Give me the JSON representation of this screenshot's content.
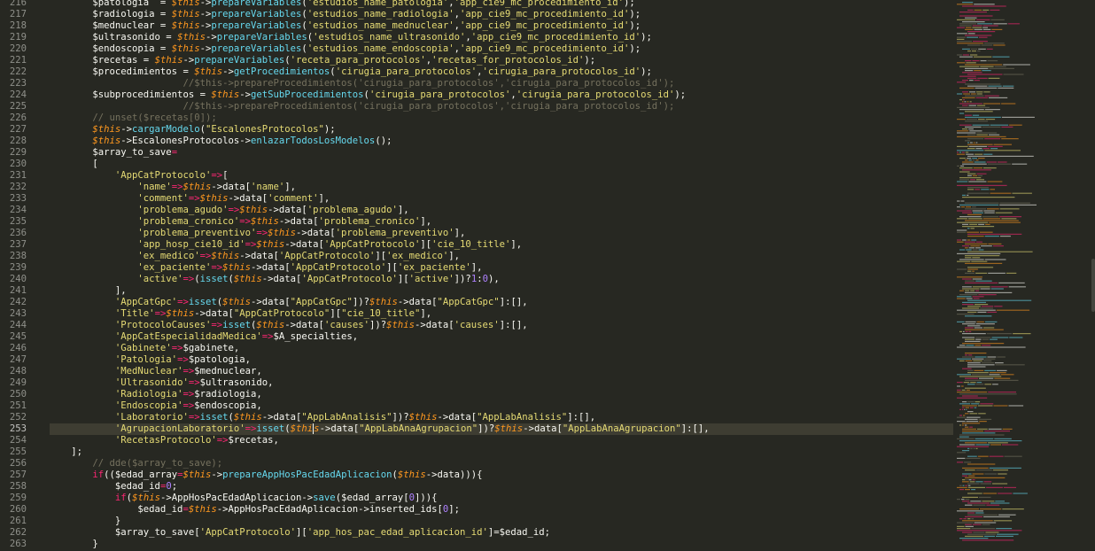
{
  "editor": {
    "first_line": 216,
    "current_line": 253,
    "caret": {
      "line": 253,
      "after_segment": 5
    },
    "scroll_fraction": 0.52,
    "colors": {
      "background": "#272822",
      "gutter_text": "#8f908a",
      "keyword": "#f92672",
      "this": "#fd971f",
      "function": "#66d9ef",
      "string": "#e6db74",
      "comment": "#75715e",
      "number": "#ae81ff",
      "text": "#f8f8f2"
    },
    "lines": [
      [
        [
          "var",
          "$patologia  = "
        ],
        [
          "th",
          "$this"
        ],
        [
          "txt",
          "->"
        ],
        [
          "fn",
          "prepareVariables"
        ],
        [
          "txt",
          "("
        ],
        [
          "str",
          "'estudios_name_patologia'"
        ],
        [
          "txt",
          ","
        ],
        [
          "str",
          "'app_cie9_mc_procedimiento_id'"
        ],
        [
          "txt",
          ");"
        ]
      ],
      [
        [
          "var",
          "$radiologia = "
        ],
        [
          "th",
          "$this"
        ],
        [
          "txt",
          "->"
        ],
        [
          "fn",
          "prepareVariables"
        ],
        [
          "txt",
          "("
        ],
        [
          "str",
          "'estudios_name_radiologia'"
        ],
        [
          "txt",
          ","
        ],
        [
          "str",
          "'app_cie9_mc_procedimiento_id'"
        ],
        [
          "txt",
          ");"
        ]
      ],
      [
        [
          "var",
          "$mednuclear = "
        ],
        [
          "th",
          "$this"
        ],
        [
          "txt",
          "->"
        ],
        [
          "fn",
          "prepareVariables"
        ],
        [
          "txt",
          "("
        ],
        [
          "str",
          "'estudios_name_mednuclear'"
        ],
        [
          "txt",
          ","
        ],
        [
          "str",
          "'app_cie9_mc_procedimiento_id'"
        ],
        [
          "txt",
          ");"
        ]
      ],
      [
        [
          "var",
          "$ultrasonido = "
        ],
        [
          "th",
          "$this"
        ],
        [
          "txt",
          "->"
        ],
        [
          "fn",
          "prepareVariables"
        ],
        [
          "txt",
          "("
        ],
        [
          "str",
          "'estudios_name_ultrasonido'"
        ],
        [
          "txt",
          ","
        ],
        [
          "str",
          "'app_cie9_mc_procedimiento_id'"
        ],
        [
          "txt",
          ");"
        ]
      ],
      [
        [
          "var",
          "$endoscopia = "
        ],
        [
          "th",
          "$this"
        ],
        [
          "txt",
          "->"
        ],
        [
          "fn",
          "prepareVariables"
        ],
        [
          "txt",
          "("
        ],
        [
          "str",
          "'estudios_name_endoscopia'"
        ],
        [
          "txt",
          ","
        ],
        [
          "str",
          "'app_cie9_mc_procedimiento_id'"
        ],
        [
          "txt",
          ");"
        ]
      ],
      [
        [
          "var",
          "$recetas = "
        ],
        [
          "th",
          "$this"
        ],
        [
          "txt",
          "->"
        ],
        [
          "fn",
          "prepareVariables"
        ],
        [
          "txt",
          "("
        ],
        [
          "str",
          "'receta_para_protocolos'"
        ],
        [
          "txt",
          ","
        ],
        [
          "str",
          "'recetas_for_protocolos_id'"
        ],
        [
          "txt",
          ");"
        ]
      ],
      [
        [
          "var",
          "$procedimientos = "
        ],
        [
          "th",
          "$this"
        ],
        [
          "txt",
          "->"
        ],
        [
          "fn",
          "getProcedimientos"
        ],
        [
          "txt",
          "("
        ],
        [
          "str",
          "'cirugia_para_protocolos'"
        ],
        [
          "txt",
          ","
        ],
        [
          "str",
          "'cirugia_para_protocolos_id'"
        ],
        [
          "txt",
          ");"
        ]
      ],
      [
        [
          "cm",
          "                //$this->prepareProcedimientos('cirugia_para_protocolos','cirugia_para_protocolos_id');"
        ]
      ],
      [
        [
          "var",
          "$subprocedimientos = "
        ],
        [
          "th",
          "$this"
        ],
        [
          "txt",
          "->"
        ],
        [
          "fn",
          "getSubProcedimientos"
        ],
        [
          "txt",
          "("
        ],
        [
          "str",
          "'cirugia_para_protocolos'"
        ],
        [
          "txt",
          ","
        ],
        [
          "str",
          "'cirugia_para_protocolos_id'"
        ],
        [
          "txt",
          ");"
        ]
      ],
      [
        [
          "cm",
          "                //$this->prepareProcedimientos('cirugia_para_protocolos','cirugia_para_protocolos_id');"
        ]
      ],
      [
        [
          "cm",
          "// unset($recetas[0]);"
        ]
      ],
      [
        [
          "th",
          "$this"
        ],
        [
          "txt",
          "->"
        ],
        [
          "fn",
          "cargarModelo"
        ],
        [
          "txt",
          "("
        ],
        [
          "str",
          "\"EscalonesProtocolos\""
        ],
        [
          "txt",
          ");"
        ]
      ],
      [
        [
          "th",
          "$this"
        ],
        [
          "txt",
          "->EscalonesProtocolos->"
        ],
        [
          "fn",
          "enlazarTodosLosModelos"
        ],
        [
          "txt",
          "();"
        ]
      ],
      [
        [
          "var",
          "$array_to_save"
        ],
        [
          "kw",
          "="
        ]
      ],
      [
        [
          "txt",
          "["
        ]
      ],
      [
        [
          "txt",
          "    "
        ],
        [
          "str",
          "'AppCatProtocolo'"
        ],
        [
          "kw",
          "=>"
        ],
        [
          "txt",
          "["
        ]
      ],
      [
        [
          "txt",
          "        "
        ],
        [
          "str",
          "'name'"
        ],
        [
          "kw",
          "=>"
        ],
        [
          "th",
          "$this"
        ],
        [
          "txt",
          "->data["
        ],
        [
          "str",
          "'name'"
        ],
        [
          "txt",
          "],"
        ]
      ],
      [
        [
          "txt",
          "        "
        ],
        [
          "str",
          "'comment'"
        ],
        [
          "kw",
          "=>"
        ],
        [
          "th",
          "$this"
        ],
        [
          "txt",
          "->data["
        ],
        [
          "str",
          "'comment'"
        ],
        [
          "txt",
          "],"
        ]
      ],
      [
        [
          "txt",
          "        "
        ],
        [
          "str",
          "'problema_agudo'"
        ],
        [
          "kw",
          "=>"
        ],
        [
          "th",
          "$this"
        ],
        [
          "txt",
          "->data["
        ],
        [
          "str",
          "'problema_agudo'"
        ],
        [
          "txt",
          "],"
        ]
      ],
      [
        [
          "txt",
          "        "
        ],
        [
          "str",
          "'problema_cronico'"
        ],
        [
          "kw",
          "=>"
        ],
        [
          "th",
          "$this"
        ],
        [
          "txt",
          "->data["
        ],
        [
          "str",
          "'problema_cronico'"
        ],
        [
          "txt",
          "],"
        ]
      ],
      [
        [
          "txt",
          "        "
        ],
        [
          "str",
          "'problema_preventivo'"
        ],
        [
          "kw",
          "=>"
        ],
        [
          "th",
          "$this"
        ],
        [
          "txt",
          "->data["
        ],
        [
          "str",
          "'problema_preventivo'"
        ],
        [
          "txt",
          "],"
        ]
      ],
      [
        [
          "txt",
          "        "
        ],
        [
          "str",
          "'app_hosp_cie10_id'"
        ],
        [
          "kw",
          "=>"
        ],
        [
          "th",
          "$this"
        ],
        [
          "txt",
          "->data["
        ],
        [
          "str",
          "'AppCatProtocolo'"
        ],
        [
          "txt",
          "]["
        ],
        [
          "str",
          "'cie_10_title'"
        ],
        [
          "txt",
          "],"
        ]
      ],
      [
        [
          "txt",
          "        "
        ],
        [
          "str",
          "'ex_medico'"
        ],
        [
          "kw",
          "=>"
        ],
        [
          "th",
          "$this"
        ],
        [
          "txt",
          "->data["
        ],
        [
          "str",
          "'AppCatProtocolo'"
        ],
        [
          "txt",
          "]["
        ],
        [
          "str",
          "'ex_medico'"
        ],
        [
          "txt",
          "],"
        ]
      ],
      [
        [
          "txt",
          "        "
        ],
        [
          "str",
          "'ex_paciente'"
        ],
        [
          "kw",
          "=>"
        ],
        [
          "th",
          "$this"
        ],
        [
          "txt",
          "->data["
        ],
        [
          "str",
          "'AppCatProtocolo'"
        ],
        [
          "txt",
          "]["
        ],
        [
          "str",
          "'ex_paciente'"
        ],
        [
          "txt",
          "],"
        ]
      ],
      [
        [
          "txt",
          "        "
        ],
        [
          "str",
          "'active'"
        ],
        [
          "kw",
          "=>"
        ],
        [
          "txt",
          "("
        ],
        [
          "fn",
          "isset"
        ],
        [
          "txt",
          "("
        ],
        [
          "th",
          "$this"
        ],
        [
          "txt",
          "->data["
        ],
        [
          "str",
          "'AppCatProtocolo'"
        ],
        [
          "txt",
          "]["
        ],
        [
          "str",
          "'active'"
        ],
        [
          "txt",
          "])?"
        ],
        [
          "num",
          "1"
        ],
        [
          "txt",
          ":"
        ],
        [
          "num",
          "0"
        ],
        [
          "txt",
          "),"
        ]
      ],
      [
        [
          "txt",
          "    ],"
        ]
      ],
      [
        [
          "txt",
          "    "
        ],
        [
          "str",
          "'AppCatGpc'"
        ],
        [
          "kw",
          "=>"
        ],
        [
          "fn",
          "isset"
        ],
        [
          "txt",
          "("
        ],
        [
          "th",
          "$this"
        ],
        [
          "txt",
          "->data["
        ],
        [
          "str",
          "\"AppCatGpc\""
        ],
        [
          "txt",
          "])?"
        ],
        [
          "th",
          "$this"
        ],
        [
          "txt",
          "->data["
        ],
        [
          "str",
          "\"AppCatGpc\""
        ],
        [
          "txt",
          "]:[],"
        ]
      ],
      [
        [
          "txt",
          "    "
        ],
        [
          "str",
          "'Title'"
        ],
        [
          "kw",
          "=>"
        ],
        [
          "th",
          "$this"
        ],
        [
          "txt",
          "->data["
        ],
        [
          "str",
          "\"AppCatProtocolo\""
        ],
        [
          "txt",
          "]["
        ],
        [
          "str",
          "\"cie_10_title\""
        ],
        [
          "txt",
          "],"
        ]
      ],
      [
        [
          "txt",
          "    "
        ],
        [
          "str",
          "'ProtocoloCauses'"
        ],
        [
          "kw",
          "=>"
        ],
        [
          "fn",
          "isset"
        ],
        [
          "txt",
          "("
        ],
        [
          "th",
          "$this"
        ],
        [
          "txt",
          "->data["
        ],
        [
          "str",
          "'causes'"
        ],
        [
          "txt",
          "])?"
        ],
        [
          "th",
          "$this"
        ],
        [
          "txt",
          "->data["
        ],
        [
          "str",
          "'causes'"
        ],
        [
          "txt",
          "]:[],"
        ]
      ],
      [
        [
          "txt",
          "    "
        ],
        [
          "str",
          "'AppCatEspecialidadMedica'"
        ],
        [
          "kw",
          "=>"
        ],
        [
          "txt",
          "$A_specialties,"
        ]
      ],
      [
        [
          "txt",
          "    "
        ],
        [
          "str",
          "'Gabinete'"
        ],
        [
          "kw",
          "=>"
        ],
        [
          "txt",
          "$gabinete,"
        ]
      ],
      [
        [
          "txt",
          "    "
        ],
        [
          "str",
          "'Patologia'"
        ],
        [
          "kw",
          "=>"
        ],
        [
          "txt",
          "$patologia,"
        ]
      ],
      [
        [
          "txt",
          "    "
        ],
        [
          "str",
          "'MedNuclear'"
        ],
        [
          "kw",
          "=>"
        ],
        [
          "txt",
          "$mednuclear,"
        ]
      ],
      [
        [
          "txt",
          "    "
        ],
        [
          "str",
          "'Ultrasonido'"
        ],
        [
          "kw",
          "=>"
        ],
        [
          "txt",
          "$ultrasonido,"
        ]
      ],
      [
        [
          "txt",
          "    "
        ],
        [
          "str",
          "'Radiologia'"
        ],
        [
          "kw",
          "=>"
        ],
        [
          "txt",
          "$radiologia,"
        ]
      ],
      [
        [
          "txt",
          "    "
        ],
        [
          "str",
          "'Endoscopia'"
        ],
        [
          "kw",
          "=>"
        ],
        [
          "txt",
          "$endoscopia,"
        ]
      ],
      [
        [
          "txt",
          "    "
        ],
        [
          "str",
          "'Laboratorio'"
        ],
        [
          "kw",
          "=>"
        ],
        [
          "fn",
          "isset"
        ],
        [
          "txt",
          "("
        ],
        [
          "th",
          "$this"
        ],
        [
          "txt",
          "->data["
        ],
        [
          "str",
          "\"AppLabAnalisis\""
        ],
        [
          "txt",
          "])?"
        ],
        [
          "th",
          "$this"
        ],
        [
          "txt",
          "->data["
        ],
        [
          "str",
          "\"AppLabAnalisis\""
        ],
        [
          "txt",
          "]:[],"
        ]
      ],
      [
        [
          "txt",
          "    "
        ],
        [
          "str",
          "'AgrupacionLaboratorio'"
        ],
        [
          "kw",
          "=>"
        ],
        [
          "fn",
          "isset"
        ],
        [
          "txt",
          "("
        ],
        [
          "th",
          "$this"
        ],
        [
          "txt",
          "->data["
        ],
        [
          "str",
          "\"AppLabAnaAgrupacion\""
        ],
        [
          "txt",
          "])?"
        ],
        [
          "th",
          "$this"
        ],
        [
          "txt",
          "->data["
        ],
        [
          "str",
          "\"AppLabAnaAgrupacion\""
        ],
        [
          "txt",
          "]:[],"
        ]
      ],
      [
        [
          "txt",
          "    "
        ],
        [
          "str",
          "'RecetasProtocolo'"
        ],
        [
          "kw",
          "=>"
        ],
        [
          "txt",
          "$recetas,"
        ]
      ],
      [
        [
          "txt",
          "];"
        ]
      ],
      [
        [
          "cm",
          "// dde($array_to_save);"
        ]
      ],
      [
        [
          "kw",
          "if"
        ],
        [
          "txt",
          "(("
        ],
        [
          "var",
          "$edad_array"
        ],
        [
          "kw",
          "="
        ],
        [
          "th",
          "$this"
        ],
        [
          "txt",
          "->"
        ],
        [
          "fn",
          "prepareAppHosPacEdadAplicacion"
        ],
        [
          "txt",
          "("
        ],
        [
          "th",
          "$this"
        ],
        [
          "txt",
          "->data))){"
        ]
      ],
      [
        [
          "txt",
          "    $edad_id"
        ],
        [
          "kw",
          "="
        ],
        [
          "num",
          "0"
        ],
        [
          "txt",
          ";"
        ]
      ],
      [
        [
          "txt",
          "    "
        ],
        [
          "kw",
          "if"
        ],
        [
          "txt",
          "("
        ],
        [
          "th",
          "$this"
        ],
        [
          "txt",
          "->AppHosPacEdadAplicacion->"
        ],
        [
          "fn",
          "save"
        ],
        [
          "txt",
          "($edad_array["
        ],
        [
          "num",
          "0"
        ],
        [
          "txt",
          "])){"
        ]
      ],
      [
        [
          "txt",
          "        $edad_id"
        ],
        [
          "kw",
          "="
        ],
        [
          "th",
          "$this"
        ],
        [
          "txt",
          "->AppHosPacEdadAplicacion->inserted_ids["
        ],
        [
          "num",
          "0"
        ],
        [
          "txt",
          "];"
        ]
      ],
      [
        [
          "txt",
          "    }"
        ]
      ],
      [
        [
          "txt",
          "    $array_to_save["
        ],
        [
          "str",
          "'AppCatProtocolo'"
        ],
        [
          "txt",
          "]["
        ],
        [
          "str",
          "'app_hos_pac_edad_aplicacion_id'"
        ],
        [
          "txt",
          "]="
        ],
        [
          "txt",
          "$edad_id;"
        ]
      ],
      [
        [
          "txt",
          "}"
        ]
      ]
    ],
    "indent": [
      2,
      2,
      2,
      2,
      2,
      2,
      2,
      2,
      2,
      2,
      2,
      2,
      2,
      2,
      2,
      2,
      2,
      2,
      2,
      2,
      2,
      2,
      2,
      2,
      2,
      2,
      2,
      2,
      2,
      2,
      2,
      2,
      2,
      2,
      2,
      2,
      2,
      2,
      2,
      1,
      2,
      2,
      2,
      2,
      2,
      2,
      2,
      2
    ]
  }
}
